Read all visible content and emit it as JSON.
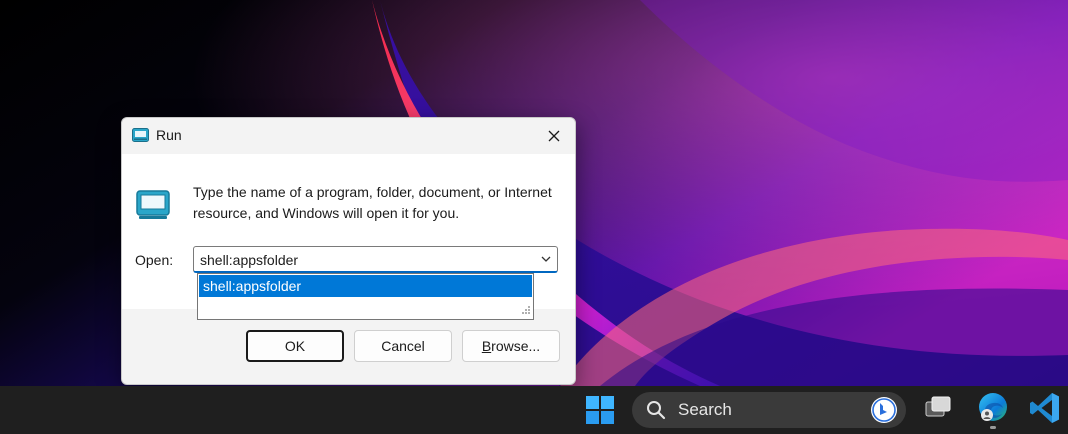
{
  "run_dialog": {
    "title": "Run",
    "description": "Type the name of a program, folder, document, or Internet resource, and Windows will open it for you.",
    "open_label": "Open:",
    "command_value": "shell:appsfolder",
    "autocomplete_items": [
      "shell:appsfolder"
    ],
    "buttons": {
      "ok": "OK",
      "cancel": "Cancel",
      "browse_underlined": "B",
      "browse_rest": "rowse..."
    }
  },
  "taskbar": {
    "search_text": "Search",
    "icons": [
      "windows-start-icon",
      "search-icon",
      "bing-icon",
      "task-view-icon",
      "edge-icon",
      "vscode-icon"
    ]
  },
  "colors": {
    "accent": "#0078d7",
    "taskbar": "#1f1f1f",
    "dialog_bg": "#f3f3f3"
  }
}
